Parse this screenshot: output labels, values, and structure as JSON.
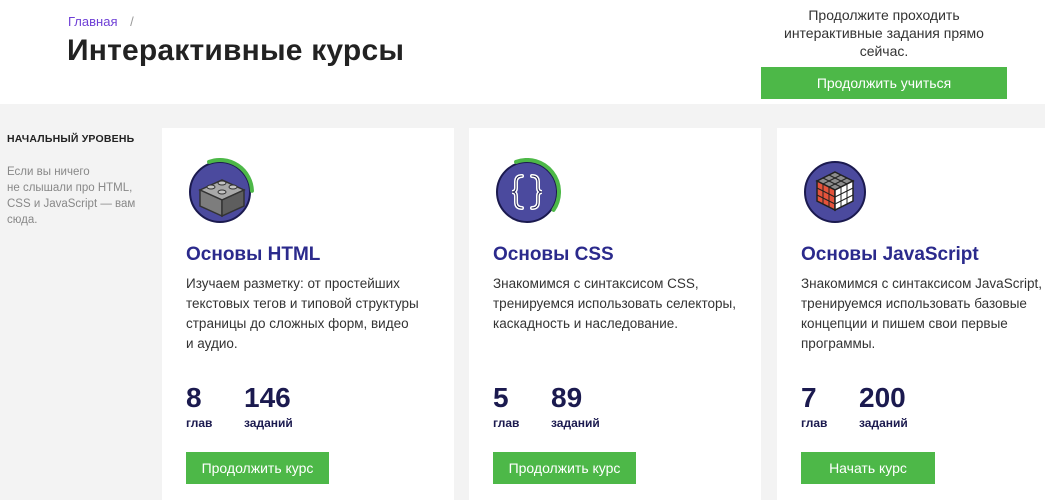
{
  "header": {
    "breadcrumb": {
      "home": "Главная",
      "separator": "/"
    },
    "title": "Интерактивные курсы"
  },
  "promo": {
    "line1": "Продолжите проходить",
    "line2": "интерактивные задания прямо сейчас.",
    "button": "Продолжить учиться"
  },
  "level": {
    "title": "НАЧАЛЬНЫЙ УРОВЕНЬ",
    "desc_lines": [
      "Если вы ничего",
      "не слышали про HTML,",
      "CSS и JavaScript — вам",
      "сюда."
    ]
  },
  "courses": [
    {
      "icon": "lego-brick-icon",
      "title": "Основы HTML",
      "desc_lines": [
        "Изучаем разметку: от простейших",
        "текстовых тегов и типовой структуры",
        "страницы до сложных форм, видео",
        "и аудио."
      ],
      "chapters": "8",
      "chapters_label": "глав",
      "tasks": "146",
      "tasks_label": "заданий",
      "button": "Продолжить курс",
      "progress": 0.3
    },
    {
      "icon": "curly-braces-icon",
      "title": "Основы CSS",
      "desc_lines": [
        "Знакомимся с синтаксисом CSS,",
        "тренируемся использовать селекторы,",
        "каскадность и наследование."
      ],
      "chapters": "5",
      "chapters_label": "глав",
      "tasks": "89",
      "tasks_label": "заданий",
      "button": "Продолжить курс",
      "progress": 0.4
    },
    {
      "icon": "rubiks-cube-icon",
      "title": "Основы JavaScript",
      "desc_lines": [
        "Знакомимся с синтаксисом JavaScript,",
        "тренируемся использовать базовые",
        "концепции и пишем свои первые",
        "программы."
      ],
      "chapters": "7",
      "chapters_label": "глав",
      "tasks": "200",
      "tasks_label": "заданий",
      "button": "Начать курс",
      "progress": 0
    }
  ],
  "colors": {
    "accent_green": "#4db848",
    "title_blue": "#2b2a8c",
    "circle_purple": "#4b4a9e",
    "link_purple": "#6e3fd6"
  }
}
